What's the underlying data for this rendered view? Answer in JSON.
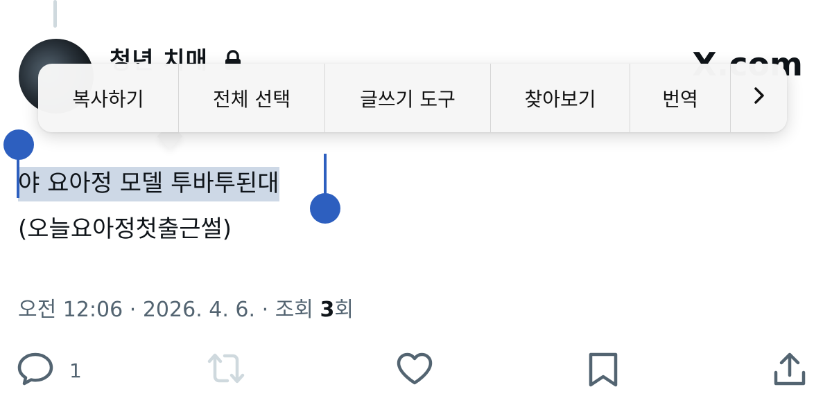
{
  "tweet": {
    "author_name": "청년 치매",
    "source": "X.com",
    "selected_text": "야 요아정 모델 투바투된대",
    "text_line2": "(오늘요아정첫출근썰)",
    "time": "오전 12:06",
    "date": "2026. 4. 6.",
    "views_label": "조회",
    "views_count": "3",
    "views_suffix": "회",
    "separator": "·",
    "reply_count": "1"
  },
  "context_menu": {
    "items": [
      "복사하기",
      "전체 선택",
      "글쓰기 도구",
      "찾아보기",
      "번역"
    ],
    "more_icon": "chevron-right-icon"
  },
  "icons": {
    "reply": "reply-icon",
    "retweet": "retweet-icon",
    "like": "heart-icon",
    "bookmark": "bookmark-icon",
    "share": "share-icon",
    "lock": "lock-icon"
  },
  "colors": {
    "selection_handle": "#2d5fbf",
    "selection_highlight": "#cdd8e6",
    "secondary_text": "#536471",
    "retweet_disabled": "#cfd9de"
  }
}
